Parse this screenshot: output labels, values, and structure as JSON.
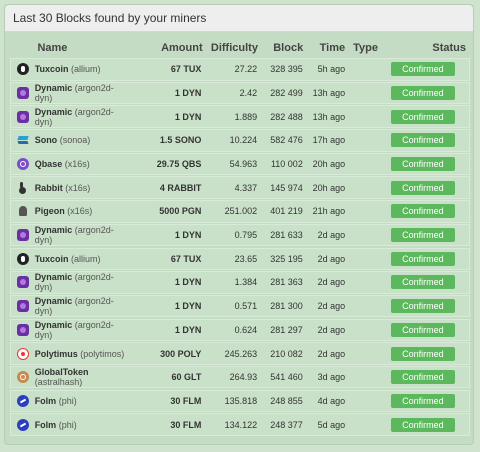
{
  "panel": {
    "title": "Last 30 Blocks found by your miners"
  },
  "columns": {
    "name": "Name",
    "amount": "Amount",
    "difficulty": "Difficulty",
    "block": "Block",
    "time": "Time",
    "type": "Type",
    "status": "Status"
  },
  "rows": [
    {
      "icon": "tux-icon",
      "coin": "Tuxcoin",
      "algo": "(allium)",
      "amount": "67 TUX",
      "difficulty": "27.22",
      "block": "328 395",
      "time": "5h ago",
      "type": "",
      "status": "Confirmed"
    },
    {
      "icon": "dyn-icon",
      "coin": "Dynamic",
      "algo": "(argon2d-dyn)",
      "amount": "1 DYN",
      "difficulty": "2.42",
      "block": "282 499",
      "time": "13h ago",
      "type": "",
      "status": "Confirmed"
    },
    {
      "icon": "dyn-icon",
      "coin": "Dynamic",
      "algo": "(argon2d-dyn)",
      "amount": "1 DYN",
      "difficulty": "1.889",
      "block": "282 488",
      "time": "13h ago",
      "type": "",
      "status": "Confirmed"
    },
    {
      "icon": "sono-icon",
      "coin": "Sono",
      "algo": "(sonoa)",
      "amount": "1.5 SONO",
      "difficulty": "10.224",
      "block": "582 476",
      "time": "17h ago",
      "type": "",
      "status": "Confirmed"
    },
    {
      "icon": "qbs-icon",
      "coin": "Qbase",
      "algo": "(x16s)",
      "amount": "29.75 QBS",
      "difficulty": "54.963",
      "block": "110 002",
      "time": "20h ago",
      "type": "",
      "status": "Confirmed"
    },
    {
      "icon": "rabbit-icon",
      "coin": "Rabbit",
      "algo": "(x16s)",
      "amount": "4 RABBIT",
      "difficulty": "4.337",
      "block": "145 974",
      "time": "20h ago",
      "type": "",
      "status": "Confirmed"
    },
    {
      "icon": "pigeon-icon",
      "coin": "Pigeon",
      "algo": "(x16s)",
      "amount": "5000 PGN",
      "difficulty": "251.002",
      "block": "401 219",
      "time": "21h ago",
      "type": "",
      "status": "Confirmed"
    },
    {
      "icon": "dyn-icon",
      "coin": "Dynamic",
      "algo": "(argon2d-dyn)",
      "amount": "1 DYN",
      "difficulty": "0.795",
      "block": "281 633",
      "time": "2d ago",
      "type": "",
      "status": "Confirmed"
    },
    {
      "icon": "tux-icon",
      "coin": "Tuxcoin",
      "algo": "(allium)",
      "amount": "67 TUX",
      "difficulty": "23.65",
      "block": "325 195",
      "time": "2d ago",
      "type": "",
      "status": "Confirmed"
    },
    {
      "icon": "dyn-icon",
      "coin": "Dynamic",
      "algo": "(argon2d-dyn)",
      "amount": "1 DYN",
      "difficulty": "1.384",
      "block": "281 363",
      "time": "2d ago",
      "type": "",
      "status": "Confirmed"
    },
    {
      "icon": "dyn-icon",
      "coin": "Dynamic",
      "algo": "(argon2d-dyn)",
      "amount": "1 DYN",
      "difficulty": "0.571",
      "block": "281 300",
      "time": "2d ago",
      "type": "",
      "status": "Confirmed"
    },
    {
      "icon": "dyn-icon",
      "coin": "Dynamic",
      "algo": "(argon2d-dyn)",
      "amount": "1 DYN",
      "difficulty": "0.624",
      "block": "281 297",
      "time": "2d ago",
      "type": "",
      "status": "Confirmed"
    },
    {
      "icon": "poly-icon",
      "coin": "Polytimus",
      "algo": "(polytimos)",
      "amount": "300 POLY",
      "difficulty": "245.263",
      "block": "210 082",
      "time": "2d ago",
      "type": "",
      "status": "Confirmed"
    },
    {
      "icon": "glt-icon",
      "coin": "GlobalToken",
      "algo": "(astralhash)",
      "amount": "60 GLT",
      "difficulty": "264.93",
      "block": "541 460",
      "time": "3d ago",
      "type": "",
      "status": "Confirmed"
    },
    {
      "icon": "flm-icon",
      "coin": "Folm",
      "algo": "(phi)",
      "amount": "30 FLM",
      "difficulty": "135.818",
      "block": "248 855",
      "time": "4d ago",
      "type": "",
      "status": "Confirmed"
    },
    {
      "icon": "flm-icon",
      "coin": "Folm",
      "algo": "(phi)",
      "amount": "30 FLM",
      "difficulty": "134.122",
      "block": "248 377",
      "time": "5d ago",
      "type": "",
      "status": "Confirmed"
    }
  ]
}
